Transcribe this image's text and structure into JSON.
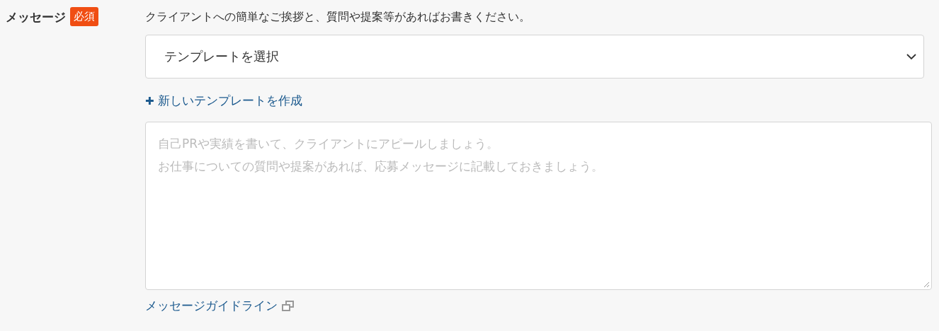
{
  "field": {
    "label": "メッセージ",
    "required_badge": "必須",
    "description": "クライアントへの簡単なご挨拶と、質問や提案等があればお書きください。",
    "template_select": {
      "value": "テンプレートを選択"
    },
    "new_template_link": {
      "icon": "✚",
      "label": "新しいテンプレートを作成"
    },
    "message": {
      "placeholder_lines": [
        "自己PRや実績を書いて、クライアントにアピールしましょう。",
        "お仕事についての質問や提案があれば、応募メッセージに記載しておきましょう。"
      ]
    },
    "guideline_link": "メッセージガイドライン"
  }
}
